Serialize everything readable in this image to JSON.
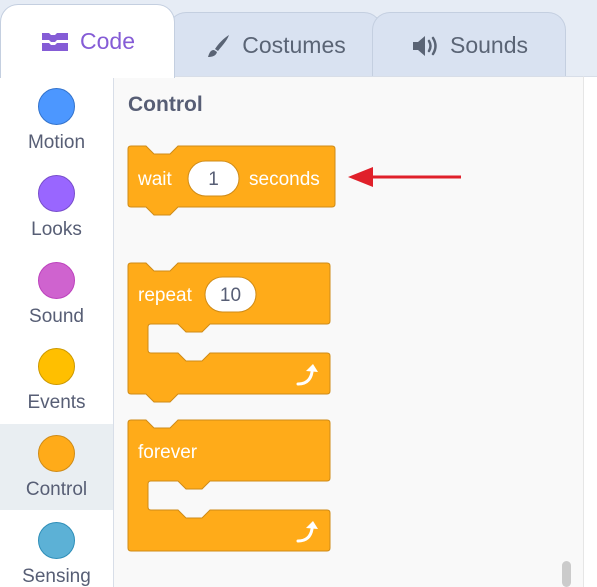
{
  "tabs": [
    {
      "label": "Code",
      "icon": "code-icon",
      "active": true
    },
    {
      "label": "Costumes",
      "icon": "brush-icon",
      "active": false
    },
    {
      "label": "Sounds",
      "icon": "speaker-icon",
      "active": false
    }
  ],
  "categories": [
    {
      "label": "Motion",
      "color": "#4c97ff"
    },
    {
      "label": "Looks",
      "color": "#9966ff"
    },
    {
      "label": "Sound",
      "color": "#cf63cf"
    },
    {
      "label": "Events",
      "color": "#ffbf00"
    },
    {
      "label": "Control",
      "color": "#ffab19",
      "selected": true
    },
    {
      "label": "Sensing",
      "color": "#5cb1d6"
    }
  ],
  "palette": {
    "section_title": "Control",
    "blocks": {
      "wait": {
        "label": "wait",
        "value": "1",
        "suffix": "seconds"
      },
      "repeat": {
        "label": "repeat",
        "value": "10"
      },
      "forever": {
        "label": "forever"
      }
    }
  },
  "colors": {
    "control_fill": "#ffab19",
    "control_stroke": "#cf8b17",
    "arrow": "#e0202a"
  }
}
